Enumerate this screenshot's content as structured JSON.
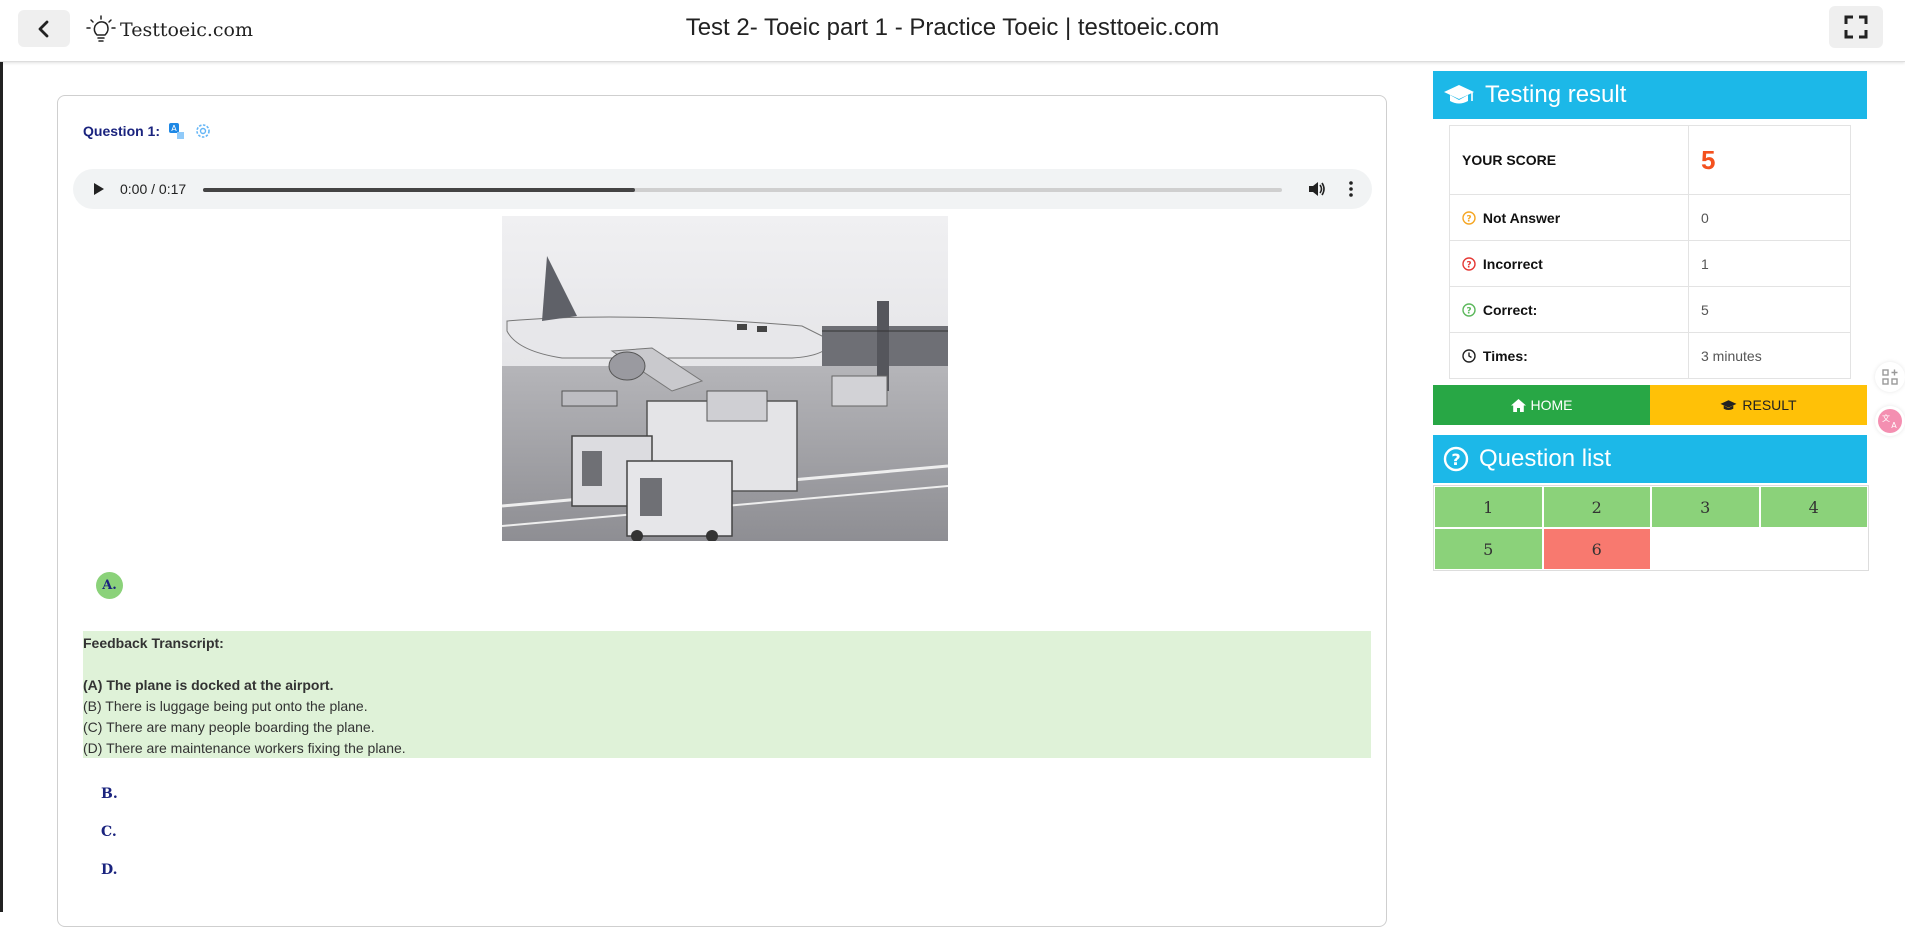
{
  "header": {
    "logo_text": "Testtoeic.com",
    "title": "Test 2- Toeic part 1 - Practice Toeic | testtoeic.com"
  },
  "question": {
    "label": "Question 1:",
    "audio": {
      "time": "0:00 / 0:17",
      "buffered_fraction": 0.4
    },
    "answers": {
      "a": "A.",
      "b": "B.",
      "c": "C.",
      "d": "D."
    },
    "feedback": {
      "title": "Feedback Transcript:",
      "lines": [
        "(A) The plane is docked at the airport.",
        "(B) There is luggage being put onto the plane.",
        "(C) There are many people boarding the plane.",
        "(D) There are maintenance workers fixing the plane."
      ]
    }
  },
  "result": {
    "title": "Testing result",
    "score_label": "YOUR SCORE",
    "score": "5",
    "rows": [
      {
        "label": "Not Answer",
        "value": "0"
      },
      {
        "label": "Incorrect",
        "value": "1"
      },
      {
        "label": "Correct:",
        "value": "5"
      },
      {
        "label": "Times:",
        "value": "3 minutes"
      }
    ],
    "home_label": "HOME",
    "result_label": "RESULT"
  },
  "question_list": {
    "title": "Question list",
    "items": [
      {
        "label": "1",
        "status": "correct"
      },
      {
        "label": "2",
        "status": "correct"
      },
      {
        "label": "3",
        "status": "correct"
      },
      {
        "label": "4",
        "status": "correct"
      },
      {
        "label": "5",
        "status": "correct"
      },
      {
        "label": "6",
        "status": "incorrect"
      }
    ]
  },
  "colors": {
    "accent": "#1cb8e8",
    "correct": "#8bd27a",
    "incorrect": "#f8796f",
    "home": "#28a745",
    "result": "#ffc107",
    "score": "#f4511e"
  },
  "icons": [
    "chevron-left-icon",
    "lightbulb-logo-icon",
    "fullscreen-icon",
    "translate-icon",
    "gear-icon",
    "play-icon",
    "volume-icon",
    "more-vert-icon",
    "graduation-cap-icon",
    "question-circle-icon",
    "clock-icon",
    "home-icon",
    "grid-add-icon",
    "translate-float-icon"
  ]
}
